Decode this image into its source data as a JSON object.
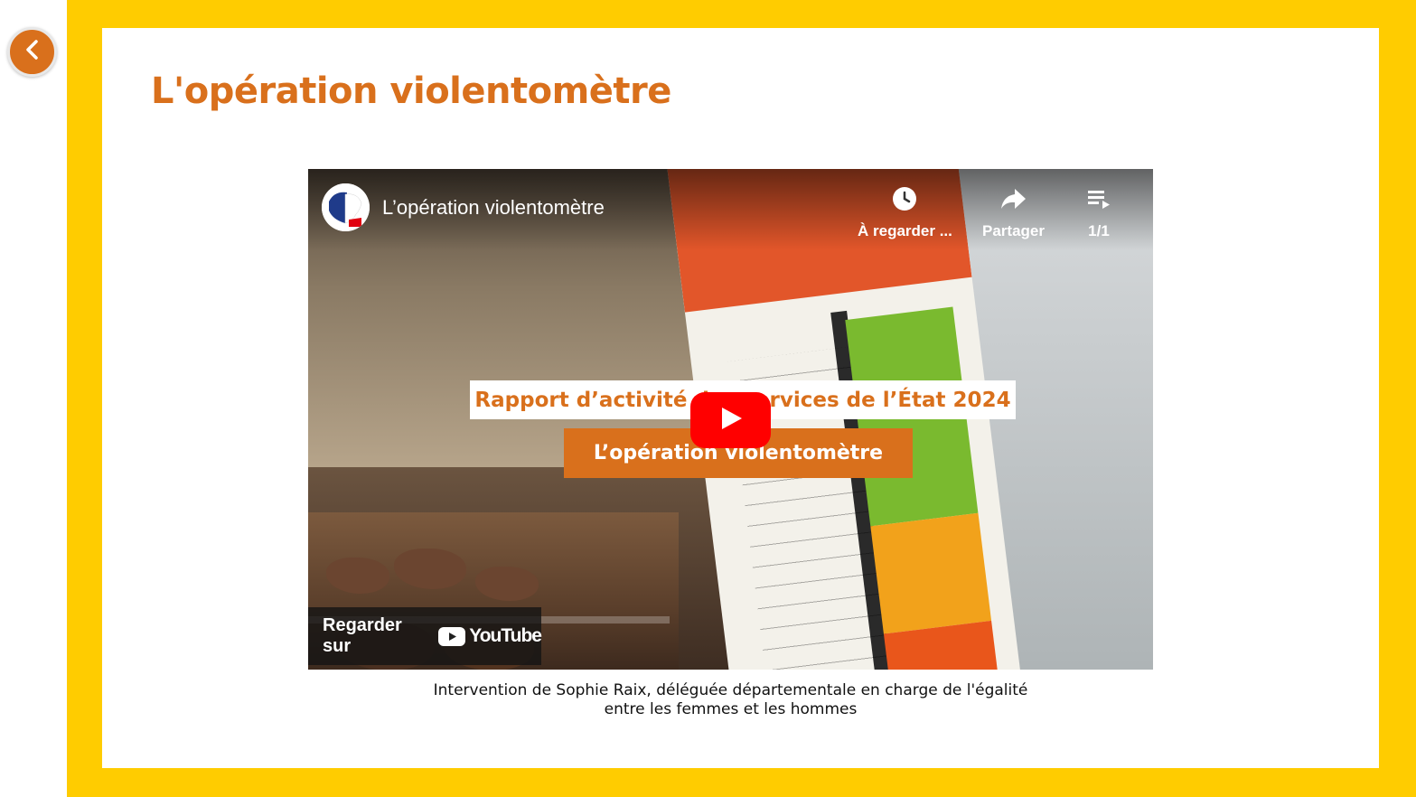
{
  "colors": {
    "frame": "#ffcc00",
    "accent": "#d9701c",
    "youtube_red": "#ff0000"
  },
  "nav": {
    "back_icon": "chevron-left-icon"
  },
  "page": {
    "title": "L'opération violentomètre"
  },
  "video": {
    "title": "L’opération violentomètre",
    "actions": [
      {
        "label": "À regarder ...",
        "icon": "clock-icon"
      },
      {
        "label": "Partager",
        "icon": "share-icon"
      },
      {
        "label": "1/1",
        "icon": "playlist-icon"
      }
    ],
    "overlay_line1": "Rapport d’activité des services de l’État 2024",
    "overlay_line2": "L’opération violentomètre",
    "watch_on_label": "Regarder sur",
    "youtube_word": "YouTube"
  },
  "caption": {
    "line1": "Intervention de Sophie Raix, déléguée départementale en charge de l'égalité",
    "line2": "entre les femmes et les hommes"
  }
}
